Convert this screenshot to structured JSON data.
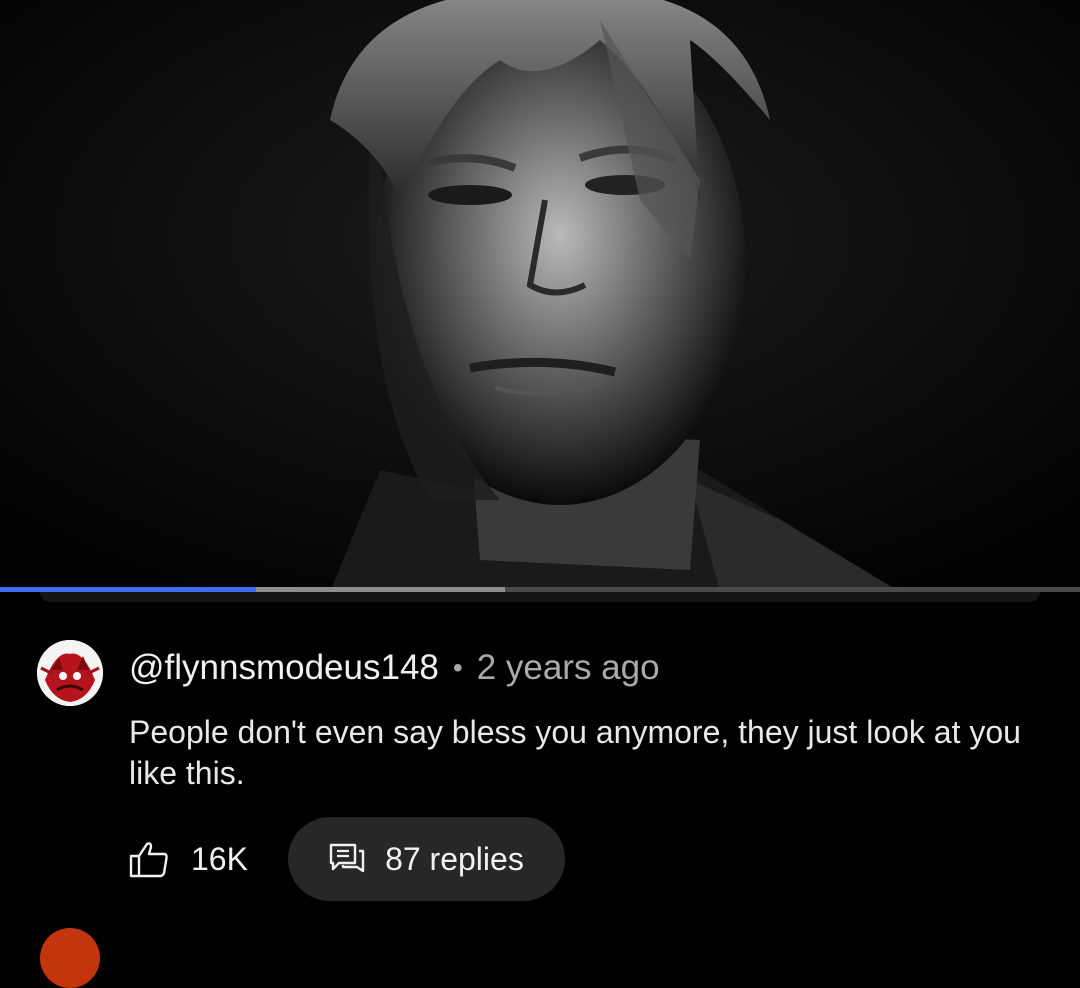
{
  "video": {
    "progress_played_percent": 23.7,
    "progress_buffered_percent": 46.8,
    "colors": {
      "played": "#3d6ef0",
      "buffered": "#8d8d8d",
      "track": "#4a4a4a"
    }
  },
  "comment": {
    "author": "@flynnsmodeus148",
    "separator": "•",
    "time": "2 years ago",
    "text": "People don't even say bless you anymore, they just look at you like this.",
    "likes": "16K",
    "replies_label": "87 replies"
  },
  "icons": {
    "like": "thumbs-up-icon",
    "replies": "chat-bubbles-icon",
    "avatar": "red-artwork-avatar"
  }
}
